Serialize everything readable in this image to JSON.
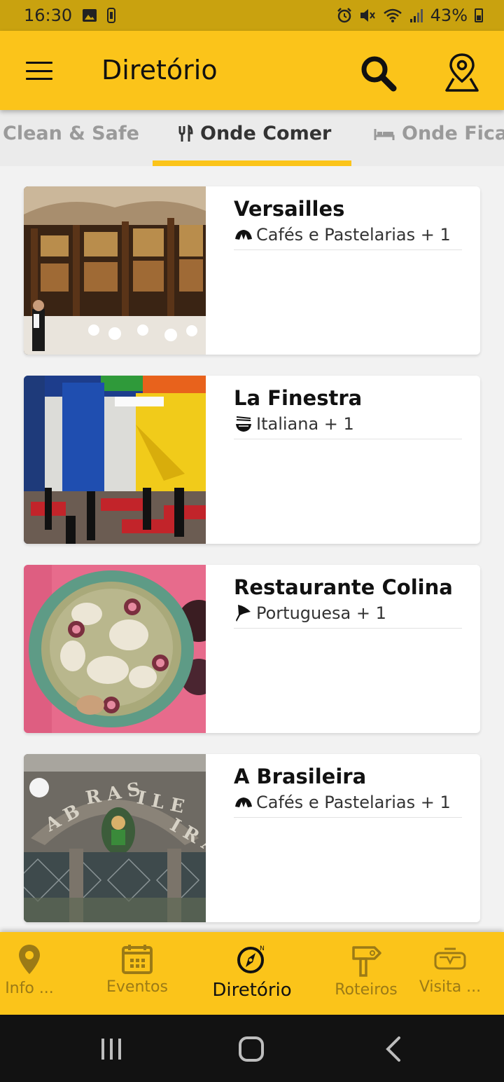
{
  "status_bar": {
    "time": "16:30",
    "battery": "43%"
  },
  "app_bar": {
    "title": "Diretório"
  },
  "tabs": [
    {
      "label": "Clean & Safe",
      "icon": "none"
    },
    {
      "label": "Onde Comer",
      "icon": "fork-knife-icon"
    },
    {
      "label": "Onde Ficar",
      "icon": "bed-icon"
    }
  ],
  "active_tab_index": 1,
  "listings": [
    {
      "name": "Versailles",
      "category": "Cafés e Pastelarias + 1",
      "category_icon": "croissant-icon"
    },
    {
      "name": "La Finestra",
      "category": "Italiana + 1",
      "category_icon": "noodles-bowl-icon"
    },
    {
      "name": "Restaurante Colina",
      "category": "Portuguesa + 1",
      "category_icon": "flag-icon"
    },
    {
      "name": "A Brasileira",
      "category": "Cafés e Pastelarias + 1",
      "category_icon": "croissant-icon"
    }
  ],
  "bottom_nav": [
    {
      "label": "Info ...",
      "icon": "location-pin-icon"
    },
    {
      "label": "Eventos",
      "icon": "calendar-icon"
    },
    {
      "label": "Diretório",
      "icon": "compass-icon"
    },
    {
      "label": "Roteiros",
      "icon": "signpost-icon"
    },
    {
      "label": "Visita ...",
      "icon": "vr-headset-icon"
    }
  ],
  "colors": {
    "accent": "#fbc41a",
    "status_bar": "#c9a20f",
    "nav_inactive": "#9b7a16"
  }
}
